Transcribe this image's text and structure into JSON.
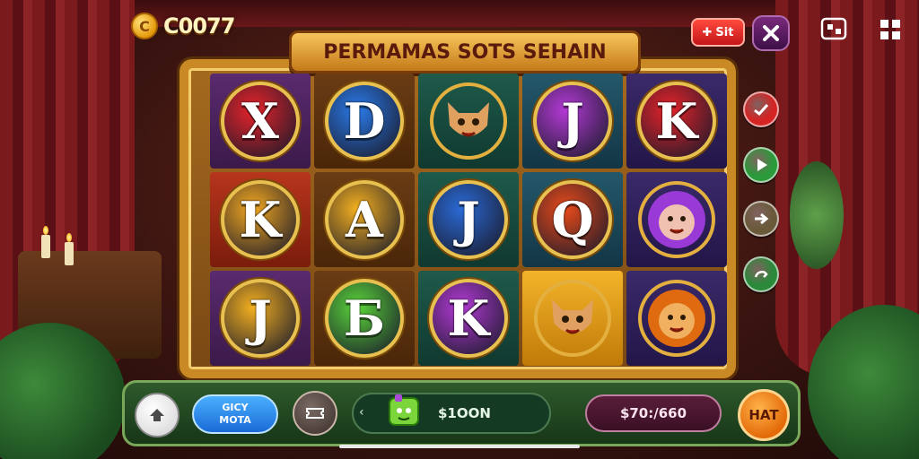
{
  "header": {
    "coin_symbol": "C",
    "coin_value": "C0077",
    "pill_button_label": "Sit",
    "pill_button_glyph": "✚"
  },
  "title": "PERMAMAS SOTS SEHAIN",
  "reels": [
    [
      {
        "label": "X",
        "kind": "letter",
        "color": "#e8232a"
      },
      {
        "label": "K",
        "kind": "letter",
        "color": "#f4a820",
        "bg": "red"
      },
      {
        "label": "J",
        "kind": "letter",
        "color": "#f4b020"
      }
    ],
    [
      {
        "label": "D",
        "kind": "letter",
        "color": "#2a7ae8"
      },
      {
        "label": "A",
        "kind": "letter",
        "color": "#f4b020"
      },
      {
        "label": "Б",
        "kind": "letter",
        "color": "#5ad63a"
      }
    ],
    [
      {
        "label": "",
        "kind": "animal",
        "animal": "cat"
      },
      {
        "label": "J",
        "kind": "letter",
        "color": "#2a6ad6"
      },
      {
        "label": "K",
        "kind": "letter",
        "color": "#b43ad6"
      }
    ],
    [
      {
        "label": "J",
        "kind": "letter",
        "color": "#b43ad6"
      },
      {
        "label": "Q",
        "kind": "letter",
        "color": "#e84a1a"
      },
      {
        "label": "",
        "kind": "animal",
        "animal": "cat",
        "bg": "hl"
      }
    ],
    [
      {
        "label": "K",
        "kind": "letter",
        "color": "#e8232a"
      },
      {
        "label": "",
        "kind": "animal",
        "animal": "lion-purple"
      },
      {
        "label": "",
        "kind": "animal",
        "animal": "lion"
      }
    ]
  ],
  "side_buttons": [
    {
      "icon": "check-icon",
      "color": "#d42424"
    },
    {
      "icon": "play-icon",
      "color": "#2a9a3a"
    },
    {
      "icon": "arrow-icon",
      "color": "#6a5a3a"
    },
    {
      "icon": "swap-icon",
      "color": "#2a8a3a"
    }
  ],
  "bottom_bar": {
    "mode_line1": "GICY",
    "mode_line2": "MOTA",
    "bet_arrow": "‹",
    "bet_value": "$1OON",
    "balance": "$70:/660",
    "spin_label": "HAT"
  },
  "colors": {
    "gold": "#c98a25",
    "banner": "#f7c55a",
    "spin": "#e36a08",
    "bottom_bar": "#2e5a2c"
  }
}
